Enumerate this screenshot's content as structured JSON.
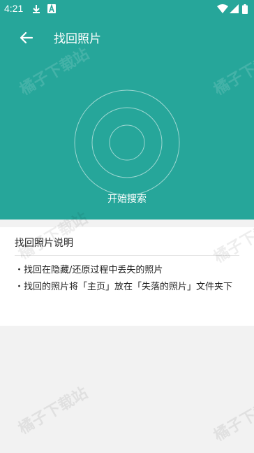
{
  "status": {
    "time": "4:21",
    "icons": [
      "download-icon",
      "a-notification-icon",
      "wifi-icon",
      "signal-icon",
      "battery-icon"
    ]
  },
  "toolbar": {
    "title": "找回照片",
    "back_icon": "arrow-left-icon"
  },
  "scan": {
    "label": "开始搜索"
  },
  "info": {
    "title": "找回照片说明",
    "lines": [
      "・找回在隐藏/还原过程中丢失的照片",
      "・找回的照片将「主页」放在「失落的照片」文件夹下"
    ]
  },
  "watermark": "橘子下载站",
  "colors": {
    "primary": "#26a69a",
    "background": "#f2f2f2",
    "card": "#ffffff"
  }
}
